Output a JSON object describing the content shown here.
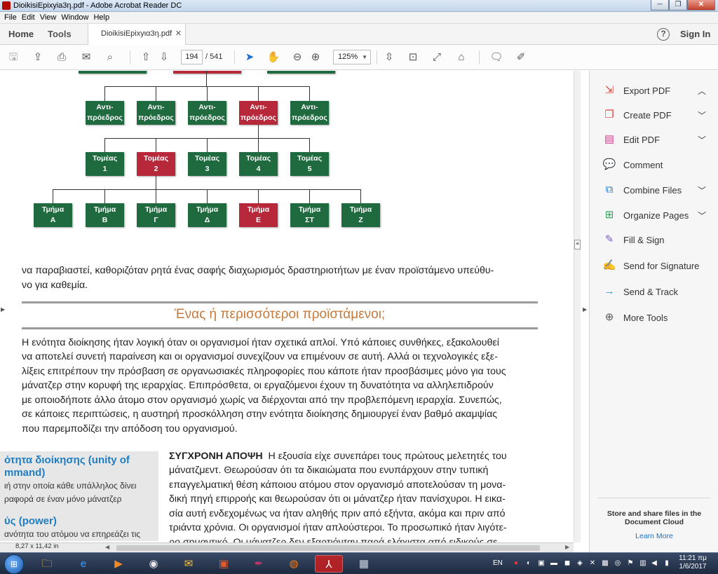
{
  "window": {
    "title": "DioikisiEpixyia3η.pdf - Adobe Acrobat Reader DC",
    "min": "─",
    "max": "❐",
    "close": "✕"
  },
  "menu": [
    "File",
    "Edit",
    "View",
    "Window",
    "Help"
  ],
  "tabs": {
    "home": "Home",
    "tools": "Tools",
    "doc": "DioikisiEpixyια3η.pdf",
    "doc_close": "✕"
  },
  "header": {
    "help": "?",
    "signin": "Sign In"
  },
  "toolbar": {
    "page_current": "194",
    "page_total": "/ 541",
    "zoom": "125%",
    "zoom_caret": "▼",
    "icons": [
      "save-icon",
      "upload-icon",
      "print-icon",
      "email-icon",
      "search-icon",
      "page-up-icon",
      "page-down-icon",
      "select-arrow-icon",
      "hand-icon",
      "zoom-out-icon",
      "zoom-in-icon",
      "scroll-mode-icon",
      "fit-page-icon",
      "full-screen-icon",
      "read-mode-icon",
      "comment-icon",
      "pen-icon"
    ]
  },
  "orgchart": {
    "row1": [
      {
        "label": "Αντι-\nπρόεδρος",
        "color": "green"
      },
      {
        "label": "Αντι-\nπρόεδρος",
        "color": "green"
      },
      {
        "label": "Αντι-\nπρόεδρος",
        "color": "green"
      },
      {
        "label": "Αντι-\nπρόεδρος",
        "color": "red"
      },
      {
        "label": "Αντι-\nπρόεδρος",
        "color": "green"
      }
    ],
    "row2": [
      {
        "label": "Τομέας\n1",
        "color": "green"
      },
      {
        "label": "Τομέας\n2",
        "color": "red"
      },
      {
        "label": "Τομέας\n3",
        "color": "green"
      },
      {
        "label": "Τομέας\n4",
        "color": "green"
      },
      {
        "label": "Τομέας\n5",
        "color": "green"
      }
    ],
    "row3": [
      {
        "label": "Τμήμα\nΑ",
        "color": "green"
      },
      {
        "label": "Τμήμα\nΒ",
        "color": "green"
      },
      {
        "label": "Τμήμα\nΓ",
        "color": "green"
      },
      {
        "label": "Τμήμα\nΔ",
        "color": "green"
      },
      {
        "label": "Τμήμα\nΕ",
        "color": "red"
      },
      {
        "label": "Τμήμα\nΣΤ",
        "color": "green"
      },
      {
        "label": "Τμήμα\nΖ",
        "color": "green"
      }
    ],
    "colors": {
      "green": "#1f6b3f",
      "red": "#b7283a"
    }
  },
  "doc": {
    "intro_lines": [
      "να παραβιαστεί, καθοριζόταν ρητά ένας σαφής διαχωρισμός δραστηριοτήτων με έναν προϊστάμενο υπεύθυ-",
      "νο για καθεμία."
    ],
    "section_heading": "Ένας ή περισσότεροι προϊστάμενοι;",
    "body_lines": [
      "Η ενότητα διοίκησης ήταν λογική όταν οι οργανισμοί ήταν σχετικά απλοί. Υπό κάποιες συνθήκες, εξακολουθεί",
      "να αποτελεί συνετή παραίνεση και οι οργανισμοί συνεχίζουν να επιμένουν σε αυτή. Αλλά οι τεχνολογικές εξε-",
      "λίξεις επιτρέπουν την πρόσβαση σε οργανωσιακές πληροφορίες που κάποτε ήταν προσβάσιμες μόνο για τους",
      "μάνατζερ στην κορυφή της ιεραρχίας. Επιπρόσθετα, οι εργαζόμενοι έχουν τη δυνατότητα να αλληλεπιδρούν",
      "με οποιοδήποτε άλλο άτομο στον οργανισμό χωρίς να διέρχονται από την προβλεπόμενη ιεραρχία. Συνεπώς,",
      "σε κάποιες περιπτώσεις, η αυστηρή προσκόλληση στην ενότητα διοίκησης δημιουργεί έναν βαθμό ακαμψίας",
      "που παρεμποδίζει την απόδοση του οργανισμού."
    ],
    "modern_label": "ΣΥΓΧΡΟΝΗ ΑΠΟΨΗ",
    "modern_lines": [
      "Η εξουσία είχε συνεπάρει τους πρώτους μελετητές του",
      "μάνατζμεντ. Θεωρούσαν ότι τα δικαιώματα που ενυπάρχουν στην τυπική",
      "επαγγελματική θέση κάποιου ατόμου στον οργανισμό αποτελούσαν τη μονα-",
      "δική πηγή επιρροής και θεωρούσαν ότι οι μάνατζερ ήταν πανίσχυροι. Η εικα-",
      "σία αυτή ενδεχομένως να ήταν αληθής πριν από εξήντα, ακόμα και πριν από",
      "τριάντα χρόνια. Οι οργανισμοί ήταν απλούστεροι. Το προσωπικό ήταν λιγότε-",
      "ρο σημαντικό. Οι μάνατζερ δεν εξαρτιόνταν παρά ελάχιστα από ειδικούς σε"
    ],
    "sidebar": {
      "t1a": "ότητα διοίκησης (unity of",
      "t1b": "mmand)",
      "d1a": "ιή στην οποία κάθε υπάλληλος δίνει",
      "d1b": "ραφορά σε έναν μόνο μάνατζερ",
      "t2": "ύς (power)",
      "d2": "ανότητα του ατόμου να επηρεάζει τις"
    },
    "page_size": "8,27 x 11,42 in"
  },
  "right_pane": {
    "items": [
      {
        "label": "Export PDF",
        "icon": "export-pdf-icon",
        "glyph": "⇲",
        "color": "#e0433b",
        "chevron": "︿"
      },
      {
        "label": "Create PDF",
        "icon": "create-pdf-icon",
        "glyph": "❐",
        "color": "#e0433b",
        "chevron": "﹀"
      },
      {
        "label": "Edit PDF",
        "icon": "edit-pdf-icon",
        "glyph": "▤",
        "color": "#d8368f",
        "chevron": "﹀"
      },
      {
        "label": "Comment",
        "icon": "comment-icon",
        "glyph": "💬",
        "color": "#f2b21a",
        "chevron": ""
      },
      {
        "label": "Combine Files",
        "icon": "combine-files-icon",
        "glyph": "⧉",
        "color": "#2f7bd6",
        "chevron": "﹀"
      },
      {
        "label": "Organize Pages",
        "icon": "organize-pages-icon",
        "glyph": "⊞",
        "color": "#2fa05a",
        "chevron": "﹀"
      },
      {
        "label": "Fill & Sign",
        "icon": "fill-sign-icon",
        "glyph": "✎",
        "color": "#7a5cc9",
        "chevron": ""
      },
      {
        "label": "Send for Signature",
        "icon": "send-signature-icon",
        "glyph": "✍",
        "color": "#3b6fd6",
        "chevron": ""
      },
      {
        "label": "Send & Track",
        "icon": "send-track-icon",
        "glyph": "→",
        "color": "#2f8fd6",
        "chevron": ""
      },
      {
        "label": "More Tools",
        "icon": "more-tools-icon",
        "glyph": "⊕",
        "color": "#555555",
        "chevron": ""
      }
    ],
    "footer_title": "Store and share files in the Document Cloud",
    "footer_link": "Learn More"
  },
  "taskbar": {
    "apps": [
      {
        "name": "explorer-icon",
        "glyph": "🗀",
        "active": false
      },
      {
        "name": "internet-explorer-icon",
        "glyph": "e",
        "active": false
      },
      {
        "name": "media-player-icon",
        "glyph": "▶",
        "active": false
      },
      {
        "name": "chrome-icon",
        "glyph": "◉",
        "active": false
      },
      {
        "name": "mail-icon",
        "glyph": "✉",
        "active": false
      },
      {
        "name": "powerpoint-icon",
        "glyph": "▣",
        "active": false
      },
      {
        "name": "acrobat-pro-icon",
        "glyph": "✒",
        "active": false
      },
      {
        "name": "firefox-icon",
        "glyph": "◍",
        "active": false
      },
      {
        "name": "acrobat-reader-icon",
        "glyph": "⅄",
        "active": true
      },
      {
        "name": "notes-icon",
        "glyph": "▦",
        "active": false
      }
    ],
    "lang": "EN",
    "time": "11:21 πμ",
    "date": "1/6/2017"
  }
}
